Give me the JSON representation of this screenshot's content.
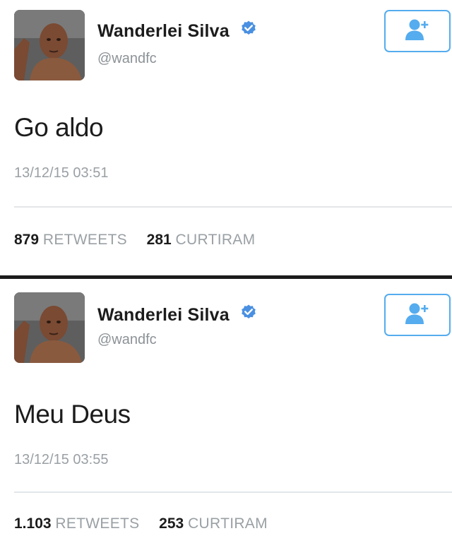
{
  "colors": {
    "accent": "#55acee",
    "verified": "#4a90e2",
    "muted_text": "#9aa0a4",
    "divider": "#1c1c1c"
  },
  "tweets": [
    {
      "author": {
        "name": "Wanderlei Silva",
        "handle": "@wandfc",
        "verified_icon": "verified-badge-icon",
        "avatar": "profile-photo"
      },
      "follow_icon": "add-user-icon",
      "text": "Go aldo",
      "timestamp": "13/12/15 03:51",
      "stats": {
        "retweets_count": "879",
        "retweets_label": "RETWEETS",
        "likes_count": "281",
        "likes_label": "CURTIRAM"
      }
    },
    {
      "author": {
        "name": "Wanderlei Silva",
        "handle": "@wandfc",
        "verified_icon": "verified-badge-icon",
        "avatar": "profile-photo"
      },
      "follow_icon": "add-user-icon",
      "text": "Meu Deus",
      "timestamp": "13/12/15 03:55",
      "stats": {
        "retweets_count": "1.103",
        "retweets_label": "RETWEETS",
        "likes_count": "253",
        "likes_label": "CURTIRAM"
      }
    }
  ]
}
